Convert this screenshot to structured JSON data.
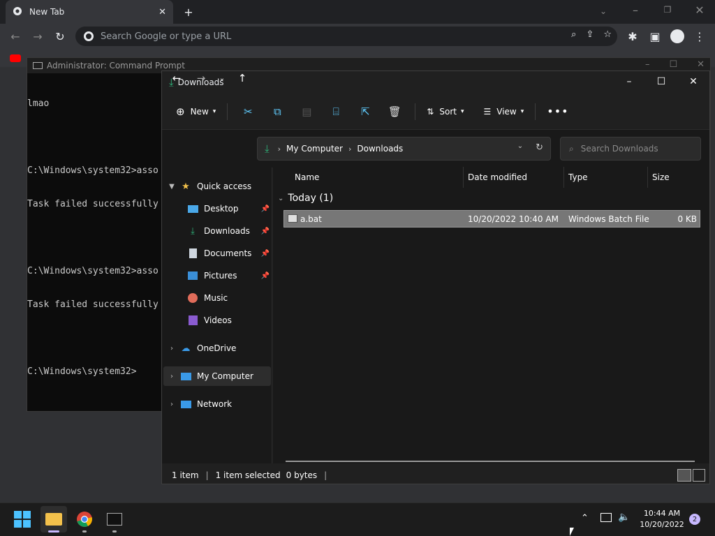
{
  "chrome": {
    "tab_title": "New Tab",
    "omnibox_placeholder": "Search Google or type a URL"
  },
  "cmd": {
    "title": "Administrator: Command Prompt",
    "lines": [
      "lmao",
      "",
      "C:\\Windows\\system32>asso",
      "Task failed successfully",
      "",
      "C:\\Windows\\system32>asso",
      "Task failed successfully",
      "",
      "C:\\Windows\\system32>"
    ]
  },
  "explorer": {
    "title": "Downloads",
    "toolbar": {
      "new_label": "New",
      "sort_label": "Sort",
      "view_label": "View"
    },
    "breadcrumb": [
      "My Computer",
      "Downloads"
    ],
    "search_placeholder": "Search Downloads",
    "nav": {
      "quick_access": "Quick access",
      "items": [
        "Desktop",
        "Downloads",
        "Documents",
        "Pictures",
        "Music",
        "Videos"
      ],
      "onedrive": "OneDrive",
      "my_computer": "My Computer",
      "network": "Network"
    },
    "columns": {
      "name": "Name",
      "date": "Date modified",
      "type": "Type",
      "size": "Size"
    },
    "group": "Today (1)",
    "file": {
      "name": "a.bat",
      "date": "10/20/2022 10:40 AM",
      "type": "Windows Batch File",
      "size": "0 KB"
    },
    "status": {
      "count": "1 item",
      "selected": "1 item selected",
      "size": "0 bytes"
    }
  },
  "taskbar": {
    "time": "10:44 AM",
    "date": "10/20/2022",
    "notifications": "2"
  },
  "colors": {
    "accent": "#60cdff",
    "folder_yellow": "#f3c14b",
    "download_green": "#2fb37a"
  }
}
